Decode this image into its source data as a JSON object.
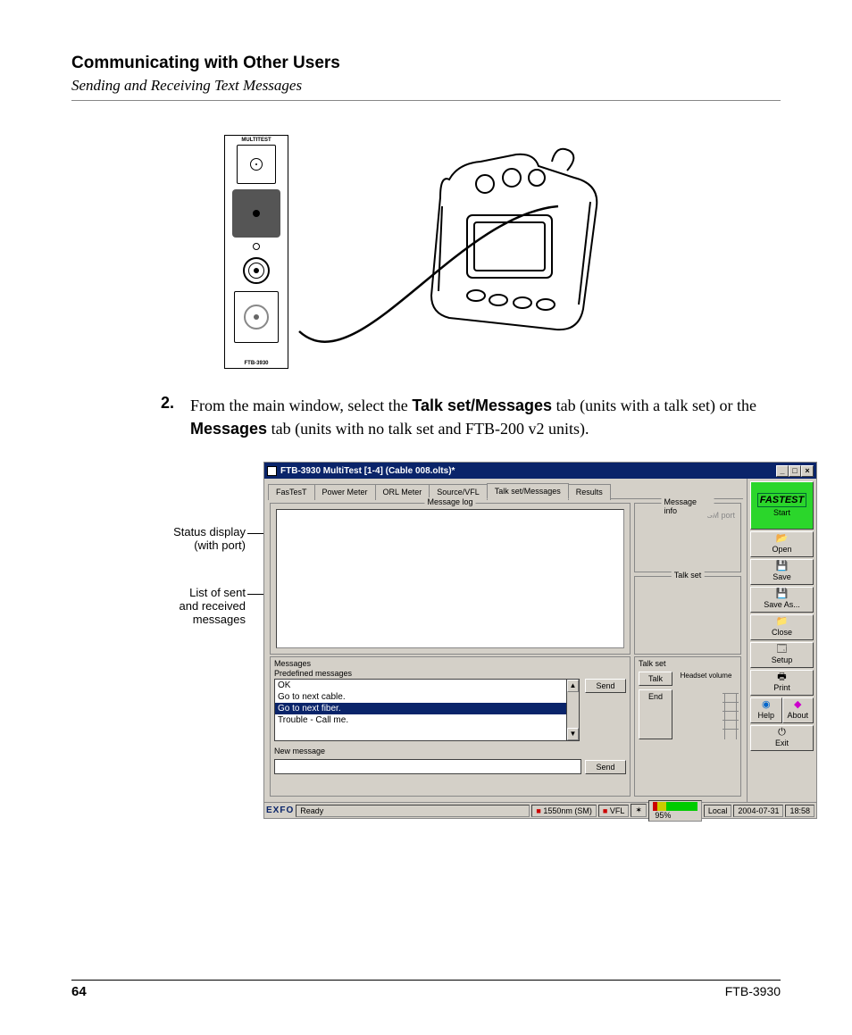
{
  "header": {
    "title": "Communicating with Other Users",
    "subtitle": "Sending and Receiving Text Messages"
  },
  "module": {
    "top_label": "MULTITEST",
    "bottom_label": "FTB-3930"
  },
  "step": {
    "number": "2.",
    "text_pre": "From the main window, select the ",
    "bold1": "Talk set/Messages",
    "text_mid1": " tab (units with a talk set) or the ",
    "bold2": "Messages",
    "text_mid2": " tab (units with no talk set and FTB-200 v2 units)."
  },
  "callouts": {
    "status_l1": "Status display",
    "status_l2": "(with port)",
    "list_l1": "List of sent",
    "list_l2": "and received",
    "list_l3": "messages"
  },
  "app": {
    "title": "FTB-3930 MultiTest [1-4] (Cable 008.olts)*",
    "winbtns": {
      "min": "_",
      "max": "□",
      "close": "×"
    },
    "tabs": [
      "FasTesT",
      "Power Meter",
      "ORL Meter",
      "Source/VFL",
      "Talk set/Messages",
      "Results"
    ],
    "active_tab_index": 4,
    "msglog_legend": "Message log",
    "msginfo_legend": "Message info",
    "msginfo_port": "SM port",
    "talkset_legend": "Talk set",
    "messages_title": "Messages",
    "predef_label": "Predefined messages",
    "predef_items": [
      "OK",
      "Go to next cable.",
      "Go to next fiber.",
      "Trouble - Call me."
    ],
    "predef_selected_index": 2,
    "newmsg_label": "New message",
    "send_label": "Send",
    "talkset_title": "Talk set",
    "talk_btn": "Talk",
    "headset_label": "Headset volume",
    "end_btn": "End",
    "sidebar": {
      "fastest": "FASTEST",
      "start": "Start",
      "open": "Open",
      "save": "Save",
      "saveas": "Save As...",
      "close": "Close",
      "setup": "Setup",
      "print": "Print",
      "help": "Help",
      "about": "About",
      "exit": "Exit"
    },
    "statusbar": {
      "exfo": "EXFO",
      "ready": "Ready",
      "wl": "1550nm (SM)",
      "vfl": "VFL",
      "bat": "95%",
      "local": "Local",
      "date": "2004-07-31",
      "time": "18:58"
    }
  },
  "footer": {
    "page": "64",
    "model": "FTB-3930"
  }
}
